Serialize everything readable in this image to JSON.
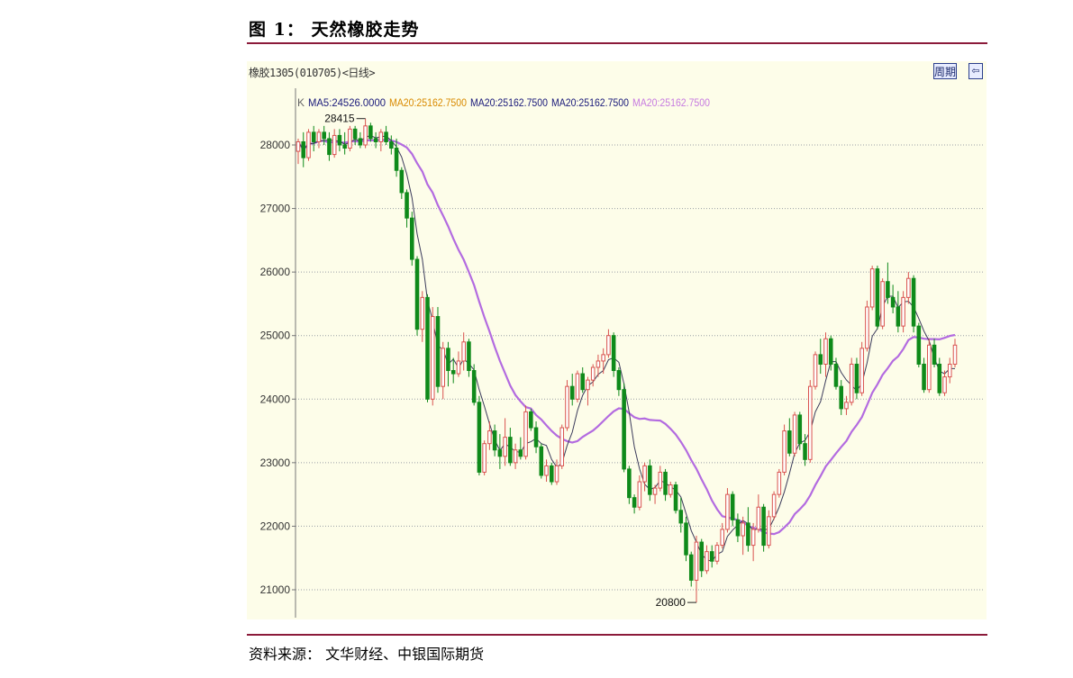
{
  "figure": {
    "title": "图 1： 天然橡胶走势",
    "source": "资料来源： 文华财经、中银国际期货"
  },
  "chart_header": {
    "instrument": "橡胶1305(010705)<日线>",
    "period_button": "周期",
    "control_icon": "arrow-left-icon"
  },
  "legend": {
    "prefix": "K",
    "items": [
      {
        "text": "MA5:24526.0000",
        "color": "#1a1a7a"
      },
      {
        "text": "MA20:25162.7500",
        "color": "#d98a00"
      },
      {
        "text": "MA20:25162.7500",
        "color": "#1a1a7a"
      },
      {
        "text": "MA20:25162.7500",
        "color": "#1a1a7a"
      },
      {
        "text": "MA20:25162.7500",
        "color": "#c77be0"
      }
    ]
  },
  "colors": {
    "up": "#d9534f",
    "down": "#0f8a1a",
    "ma5": "#3a3a5a",
    "ma20": "#b36be0",
    "grid": "#9aa0a6",
    "bg": "#fdfde9"
  },
  "chart_data": {
    "type": "candlestick",
    "title": "图 1： 天然橡胶走势",
    "ylim": [
      20700,
      28700
    ],
    "yticks": [
      21000,
      22000,
      23000,
      24000,
      25000,
      26000,
      27000,
      28000
    ],
    "annotations": [
      {
        "text": "28415",
        "value": 28415,
        "bar_index": 13
      },
      {
        "text": "20800",
        "value": 20800,
        "bar_index": 77
      }
    ],
    "series": [
      {
        "name": "MA5",
        "value": 24526.0
      },
      {
        "name": "MA20",
        "value": 25162.75
      }
    ],
    "candles": [
      [
        27900,
        28100,
        27700,
        28050
      ],
      [
        28050,
        28200,
        27650,
        27800
      ],
      [
        27800,
        28250,
        27750,
        28200
      ],
      [
        28200,
        28300,
        27900,
        28050
      ],
      [
        28050,
        28250,
        27950,
        28200
      ],
      [
        28200,
        28300,
        28000,
        28100
      ],
      [
        28100,
        28200,
        27750,
        27850
      ],
      [
        27850,
        28250,
        27800,
        28150
      ],
      [
        28150,
        28250,
        27900,
        28000
      ],
      [
        28000,
        28200,
        27850,
        27950
      ],
      [
        27950,
        28300,
        27900,
        28250
      ],
      [
        28250,
        28300,
        28000,
        28100
      ],
      [
        28100,
        28200,
        27950,
        28000
      ],
      [
        28000,
        28415,
        27950,
        28300
      ],
      [
        28300,
        28350,
        28050,
        28100
      ],
      [
        28100,
        28200,
        27950,
        28050
      ],
      [
        28050,
        28250,
        27900,
        28200
      ],
      [
        28200,
        28300,
        28000,
        28050
      ],
      [
        28050,
        28150,
        27850,
        27950
      ],
      [
        27950,
        28100,
        27500,
        27600
      ],
      [
        27600,
        27650,
        27150,
        27250
      ],
      [
        27250,
        27300,
        26700,
        26850
      ],
      [
        26850,
        26950,
        26100,
        26200
      ],
      [
        26200,
        26250,
        25000,
        25100
      ],
      [
        25100,
        25700,
        24900,
        25600
      ],
      [
        25600,
        25650,
        23950,
        24000
      ],
      [
        24000,
        25450,
        23900,
        25300
      ],
      [
        25300,
        25450,
        24100,
        24200
      ],
      [
        24200,
        24900,
        24000,
        24800
      ],
      [
        24800,
        24900,
        24200,
        24450
      ],
      [
        24450,
        24650,
        24250,
        24400
      ],
      [
        24400,
        24750,
        24350,
        24600
      ],
      [
        24600,
        25050,
        24450,
        24900
      ],
      [
        24900,
        24950,
        24350,
        24450
      ],
      [
        24450,
        24550,
        23900,
        23950
      ],
      [
        23950,
        24050,
        22800,
        22850
      ],
      [
        22850,
        23350,
        22800,
        23300
      ],
      [
        23300,
        23650,
        23200,
        23500
      ],
      [
        23500,
        23600,
        23100,
        23200
      ],
      [
        23200,
        23450,
        22900,
        23100
      ],
      [
        23100,
        23700,
        22950,
        23400
      ],
      [
        23400,
        23550,
        22950,
        23000
      ],
      [
        23000,
        23300,
        22900,
        23200
      ],
      [
        23200,
        23400,
        23050,
        23100
      ],
      [
        23100,
        23900,
        23050,
        23800
      ],
      [
        23800,
        23850,
        23500,
        23550
      ],
      [
        23550,
        23650,
        23150,
        23250
      ],
      [
        23250,
        23300,
        22750,
        22800
      ],
      [
        22800,
        23050,
        22700,
        22950
      ],
      [
        22950,
        23000,
        22650,
        22700
      ],
      [
        22700,
        23050,
        22650,
        22950
      ],
      [
        22950,
        23600,
        22900,
        23550
      ],
      [
        23550,
        24300,
        23500,
        24200
      ],
      [
        24200,
        24400,
        23900,
        24000
      ],
      [
        24000,
        24450,
        23950,
        24400
      ],
      [
        24400,
        24500,
        24100,
        24150
      ],
      [
        24150,
        24350,
        23900,
        24300
      ],
      [
        24300,
        24550,
        24200,
        24500
      ],
      [
        24500,
        24700,
        24350,
        24600
      ],
      [
        24600,
        24800,
        24400,
        24700
      ],
      [
        24700,
        25100,
        24650,
        25000
      ],
      [
        25000,
        25050,
        24350,
        24450
      ],
      [
        24450,
        24500,
        24050,
        24150
      ],
      [
        24150,
        24250,
        22850,
        22900
      ],
      [
        22900,
        22950,
        22350,
        22450
      ],
      [
        22450,
        22500,
        22200,
        22300
      ],
      [
        22300,
        22800,
        22250,
        22700
      ],
      [
        22700,
        23000,
        22550,
        22950
      ],
      [
        22950,
        23050,
        22400,
        22500
      ],
      [
        22500,
        22650,
        22350,
        22600
      ],
      [
        22600,
        22950,
        22550,
        22850
      ],
      [
        22850,
        22900,
        22400,
        22500
      ],
      [
        22500,
        22700,
        22450,
        22650
      ],
      [
        22650,
        22700,
        22200,
        22250
      ],
      [
        22250,
        22450,
        21900,
        22050
      ],
      [
        22050,
        22150,
        21450,
        21550
      ],
      [
        21550,
        21600,
        21050,
        21150
      ],
      [
        21150,
        21850,
        20800,
        21750
      ],
      [
        21750,
        21800,
        21200,
        21300
      ],
      [
        21300,
        21700,
        21250,
        21600
      ],
      [
        21600,
        21700,
        21350,
        21450
      ],
      [
        21450,
        21750,
        21400,
        21700
      ],
      [
        21700,
        22050,
        21650,
        21950
      ],
      [
        21950,
        22600,
        21900,
        22500
      ],
      [
        22500,
        22550,
        22000,
        22100
      ],
      [
        22100,
        22200,
        21750,
        21850
      ],
      [
        21850,
        22150,
        21550,
        22050
      ],
      [
        22050,
        22300,
        21600,
        21700
      ],
      [
        21700,
        22050,
        21450,
        21950
      ],
      [
        21950,
        22500,
        21900,
        22300
      ],
      [
        22300,
        22350,
        21600,
        21700
      ],
      [
        21700,
        22250,
        21650,
        22150
      ],
      [
        22150,
        22550,
        22100,
        22500
      ],
      [
        22500,
        22900,
        22450,
        22850
      ],
      [
        22850,
        23600,
        22800,
        23500
      ],
      [
        23500,
        23700,
        23100,
        23150
      ],
      [
        23150,
        23800,
        23100,
        23750
      ],
      [
        23750,
        23800,
        23200,
        23300
      ],
      [
        23300,
        23450,
        22950,
        23050
      ],
      [
        23050,
        24300,
        23000,
        24200
      ],
      [
        24200,
        24750,
        24150,
        24700
      ],
      [
        24700,
        24950,
        24400,
        24550
      ],
      [
        24550,
        25050,
        24350,
        24950
      ],
      [
        24950,
        25000,
        24450,
        24550
      ],
      [
        24550,
        24650,
        24150,
        24200
      ],
      [
        24200,
        24300,
        23750,
        23850
      ],
      [
        23850,
        24050,
        23750,
        23950
      ],
      [
        23950,
        24650,
        23900,
        24550
      ],
      [
        24550,
        24650,
        24000,
        24100
      ],
      [
        24100,
        24900,
        24050,
        24800
      ],
      [
        24800,
        25550,
        24750,
        25450
      ],
      [
        25450,
        26100,
        25400,
        26050
      ],
      [
        26050,
        26100,
        25100,
        25150
      ],
      [
        25150,
        25900,
        25100,
        25850
      ],
      [
        25850,
        26150,
        25500,
        25600
      ],
      [
        25600,
        25800,
        25350,
        25450
      ],
      [
        25450,
        25700,
        25050,
        25150
      ],
      [
        25150,
        25700,
        25050,
        25600
      ],
      [
        25600,
        26000,
        25500,
        25900
      ],
      [
        25900,
        25950,
        25050,
        25150
      ],
      [
        25150,
        25200,
        24500,
        24550
      ],
      [
        24550,
        24650,
        24100,
        24150
      ],
      [
        24150,
        24950,
        24100,
        24850
      ],
      [
        24850,
        24950,
        24500,
        24550
      ],
      [
        24550,
        24650,
        24050,
        24100
      ],
      [
        24100,
        24450,
        24050,
        24350
      ],
      [
        24350,
        24650,
        24250,
        24550
      ],
      [
        24550,
        24950,
        24500,
        24850
      ]
    ]
  }
}
